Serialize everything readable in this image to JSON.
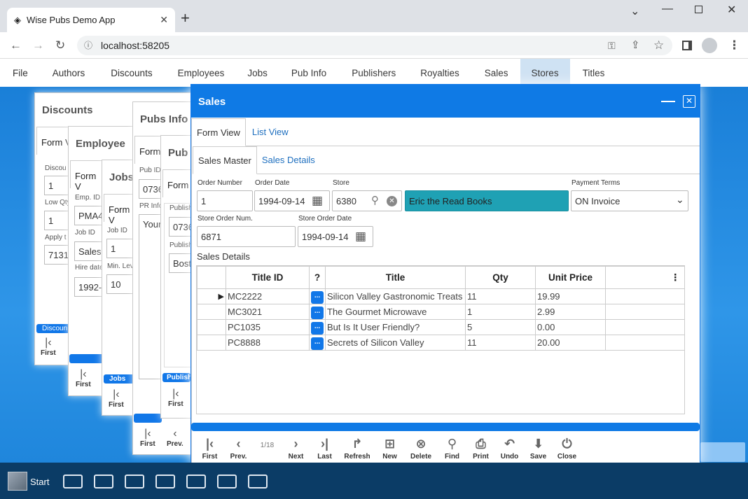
{
  "browser": {
    "tab_title": "Wise Pubs Demo App",
    "url": "localhost:58205"
  },
  "menu": {
    "items": [
      "File",
      "Authors",
      "Discounts",
      "Employees",
      "Jobs",
      "Pub Info",
      "Publishers",
      "Royalties",
      "Sales",
      "Stores",
      "Titles"
    ],
    "active": "Stores"
  },
  "bg_windows": {
    "discounts": {
      "title": "Discounts",
      "tab": "Form V",
      "lbl1": "Discou",
      "val1": "1",
      "lbl2": "Low Qty",
      "val2": "1",
      "lbl3": "Apply t",
      "val3": "7131",
      "strip": "Discoun",
      "nav": "First"
    },
    "employee": {
      "title": "Employee",
      "tab": "Form V",
      "lbl1": "Emp. ID",
      "val1": "PMA4",
      "lbl2": "Job ID",
      "val2": "Sales",
      "lbl3": "Hire date",
      "val3": "1992-",
      "nav": "First"
    },
    "jobs": {
      "title": "Jobs",
      "tab": "Form V",
      "lbl1": "Job ID",
      "val1": "1",
      "lbl2": "Min. Lev",
      "val2": "10",
      "strip": "Jobs",
      "nav": "First"
    },
    "pubsinfo": {
      "title": "Pubs Info",
      "tab": "Form",
      "lbl1": "Pub ID",
      "val1": "0736",
      "lbl2": "PR Info",
      "val2": "Your",
      "nav1": "First",
      "nav2": "Prev."
    },
    "publishers": {
      "title": "Pub",
      "tab": "Form",
      "lbl1": "Publish",
      "val1": "0736",
      "lbl2": "Publish",
      "val2": "Bost",
      "strip": "Publish",
      "nav": "First"
    }
  },
  "sales": {
    "title": "Sales",
    "view_tabs": [
      "Form View",
      "List View"
    ],
    "sub_tabs": [
      "Sales Master",
      "Sales Details"
    ],
    "fields": {
      "order_number": {
        "label": "Order Number",
        "value": "1"
      },
      "order_date": {
        "label": "Order Date",
        "value": "1994-09-14"
      },
      "store": {
        "label": "Store",
        "value": "6380",
        "name": "Eric the Read Books"
      },
      "payment_terms": {
        "label": "Payment Terms",
        "value": "ON Invoice"
      },
      "store_order_num": {
        "label": "Store Order Num.",
        "value": "6871"
      },
      "store_order_date": {
        "label": "Store Order Date",
        "value": "1994-09-14"
      }
    },
    "details_label": "Sales Details",
    "columns": [
      "Title ID",
      "?",
      "Title",
      "Qty",
      "Unit Price"
    ],
    "rows": [
      {
        "title_id": "MC2222",
        "btn": "...",
        "title": "Silicon Valley Gastronomic Treats",
        "qty": "11",
        "price": "19.99"
      },
      {
        "title_id": "MC3021",
        "btn": "...",
        "title": "The Gourmet Microwave",
        "qty": "1",
        "price": "2.99"
      },
      {
        "title_id": "PC1035",
        "btn": "...",
        "title": "But Is It User Friendly?",
        "qty": "5",
        "price": "0.00"
      },
      {
        "title_id": "PC8888",
        "btn": "...",
        "title": "Secrets of Silicon Valley",
        "qty": "11",
        "price": "20.00"
      }
    ],
    "record_pos": "1/18",
    "toolbar": [
      "First",
      "Prev.",
      "Next",
      "Last",
      "Refresh",
      "New",
      "Delete",
      "Find",
      "Print",
      "Undo",
      "Save",
      "Close"
    ]
  },
  "taskbar": {
    "start_label": "Start"
  },
  "colors": {
    "accent": "#0f7ae5",
    "store_name_bg": "#1fa1b4",
    "taskbar": "#0b3c66"
  }
}
